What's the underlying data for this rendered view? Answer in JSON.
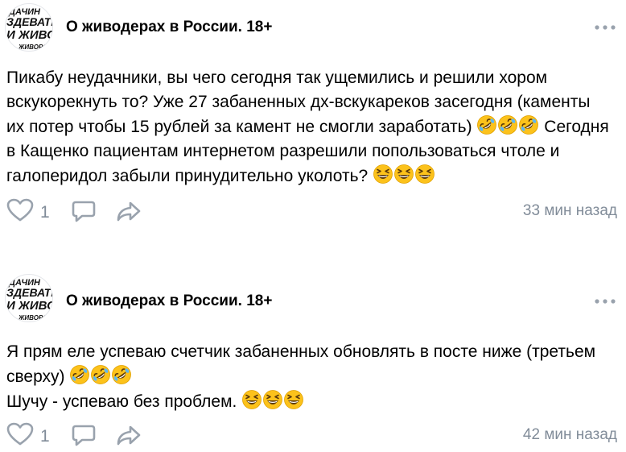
{
  "posts": [
    {
      "group_name": "О живодерах в России. 18+",
      "avatar_text": [
        "ДАЧИН",
        "ЗДЕВАТЕ",
        "И ЖИВО",
        "ЖИВОРО"
      ],
      "text_segments": [
        "Пикабу неудачники, вы чего сегодня так ущемились и решили хором",
        "вскукорекнуть то? Уже 27 забаненных дх-вскукареков засегодня (каменты",
        "их потер чтобы 15 рублей за камент не смогли заработать)",
        "Сегодня",
        "в Кащенко пациентам интернетом разрешили попользоваться чтоле и",
        "галоперидол забыли принудительно уколоть?"
      ],
      "emoji_groups": [
        [
          "rolling-on-floor-laughing",
          "rolling-on-floor-laughing",
          "rolling-on-floor-laughing"
        ],
        [
          "grinning-squinting",
          "grinning-squinting",
          "grinning-squinting"
        ]
      ],
      "likes": "1",
      "time": "33 мин назад"
    },
    {
      "group_name": "О живодерах в России. 18+",
      "avatar_text": [
        "ДАЧИН",
        "ЗДЕВАТЕ",
        "И ЖИВО",
        "ЖИВОРО"
      ],
      "text_segments": [
        "Я прям еле успеваю счетчик забаненных обновлять в посте ниже (третьем",
        "сверху)",
        "Шучу - успеваю без проблем."
      ],
      "emoji_groups": [
        [
          "rolling-on-floor-laughing",
          "rolling-on-floor-laughing",
          "rolling-on-floor-laughing"
        ],
        [
          "grinning-squinting",
          "grinning-squinting",
          "grinning-squinting"
        ]
      ],
      "likes": "1",
      "time": "42 мин назад"
    }
  ],
  "icons": {
    "like": "heart-outline-icon",
    "comment": "comment-bubble-icon",
    "share": "share-arrow-icon",
    "more": "more-dots-icon"
  },
  "colors": {
    "secondary_text": "#818c99",
    "icon": "#99a2ad",
    "emoji_face": "#fcc21b"
  }
}
